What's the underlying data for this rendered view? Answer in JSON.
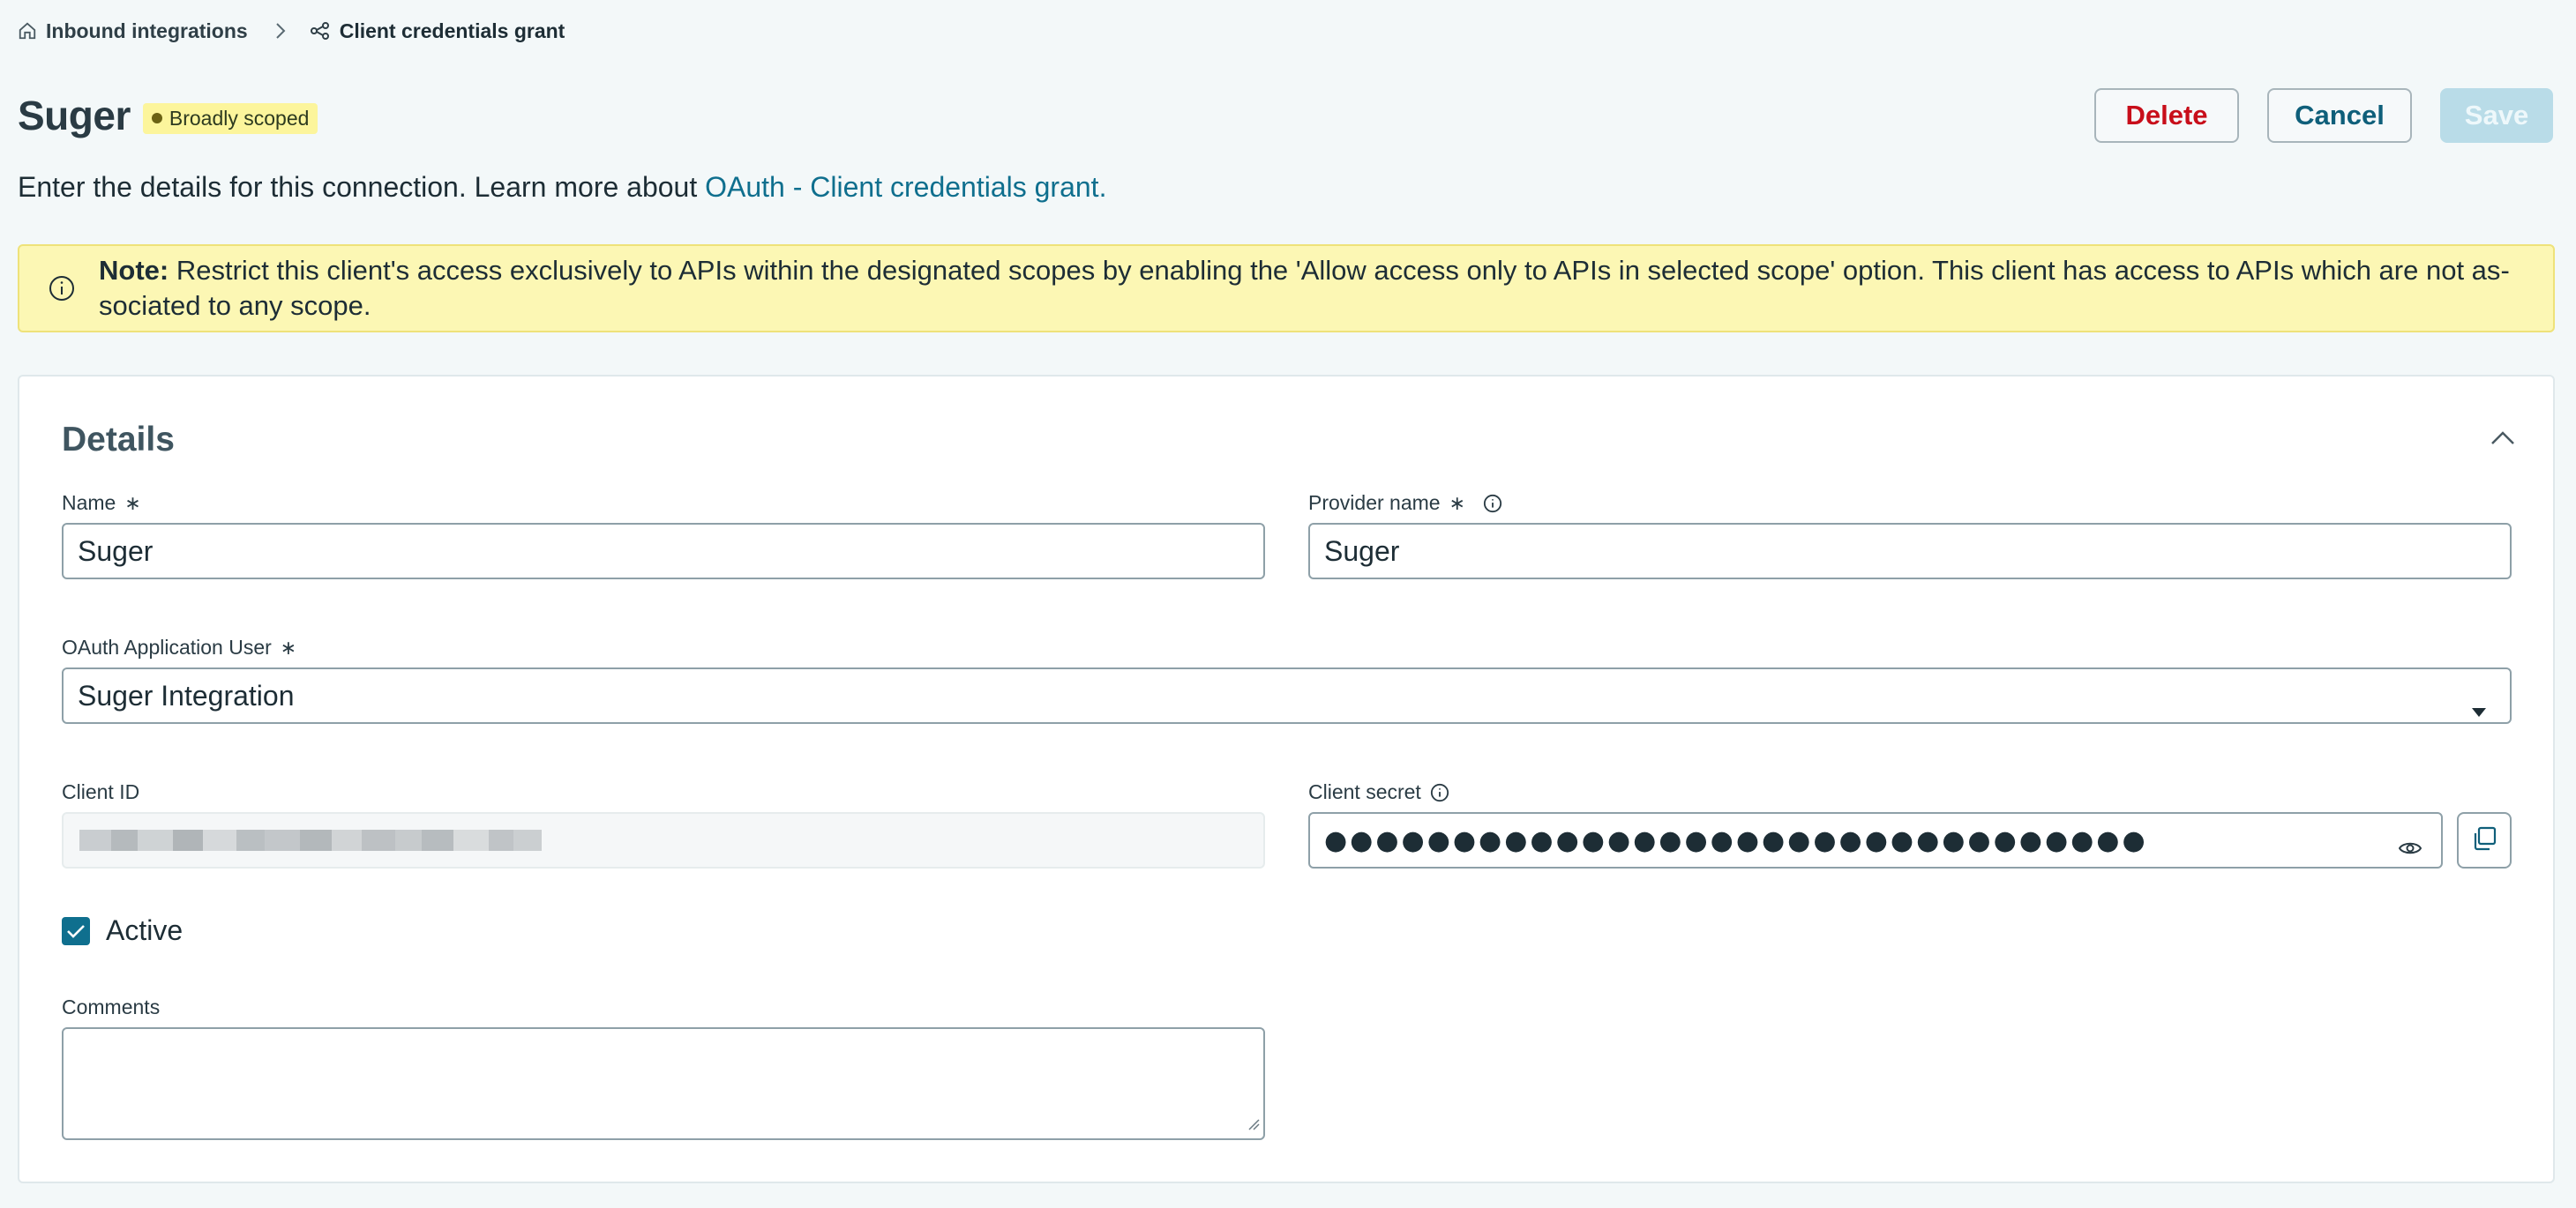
{
  "breadcrumb": {
    "parent_label": "Inbound integrations",
    "current_label": "Client credentials grant"
  },
  "header": {
    "title": "Suger",
    "badge": "Broadly scoped"
  },
  "actions": {
    "delete_label": "Delete",
    "cancel_label": "Cancel",
    "save_label": "Save"
  },
  "intro": {
    "text": "Enter the details for this connection. Learn more about ",
    "link": "OAuth - Client credentials grant."
  },
  "note": {
    "label": "Note:",
    "text": " Restrict this client's access exclusively to APIs within the designated scopes by enabling the 'Allow access only to APIs in selected scope' option. This client has access to APIs which are not as­sociated to any scope."
  },
  "details": {
    "title": "Details",
    "name": {
      "label": "Name",
      "required": "∗",
      "value": "Suger"
    },
    "provider_name": {
      "label": "Provider name",
      "required": "∗",
      "value": "Suger"
    },
    "oauth_user": {
      "label": "OAuth Application User",
      "required": "∗",
      "value": "Suger Integration"
    },
    "client_id": {
      "label": "Client ID"
    },
    "client_secret": {
      "label": "Client secret",
      "value": "●●●●●●●●●●●●●●●●●●●●●●●●●●●●●●●●"
    },
    "active": {
      "label": "Active",
      "checked": true
    },
    "comments": {
      "label": "Comments",
      "value": ""
    }
  },
  "colors": {
    "accent": "#0f6f8e",
    "danger": "#c80e1a",
    "note_bg": "#fcf7b4",
    "badge_bg": "#fcf59c"
  },
  "icons": [
    "home-icon",
    "chevron-right-icon",
    "integration-icon",
    "info-icon",
    "chevron-up-icon",
    "caret-down-icon",
    "eye-icon",
    "copy-icon",
    "checkmark-icon",
    "resize-grip-icon"
  ]
}
